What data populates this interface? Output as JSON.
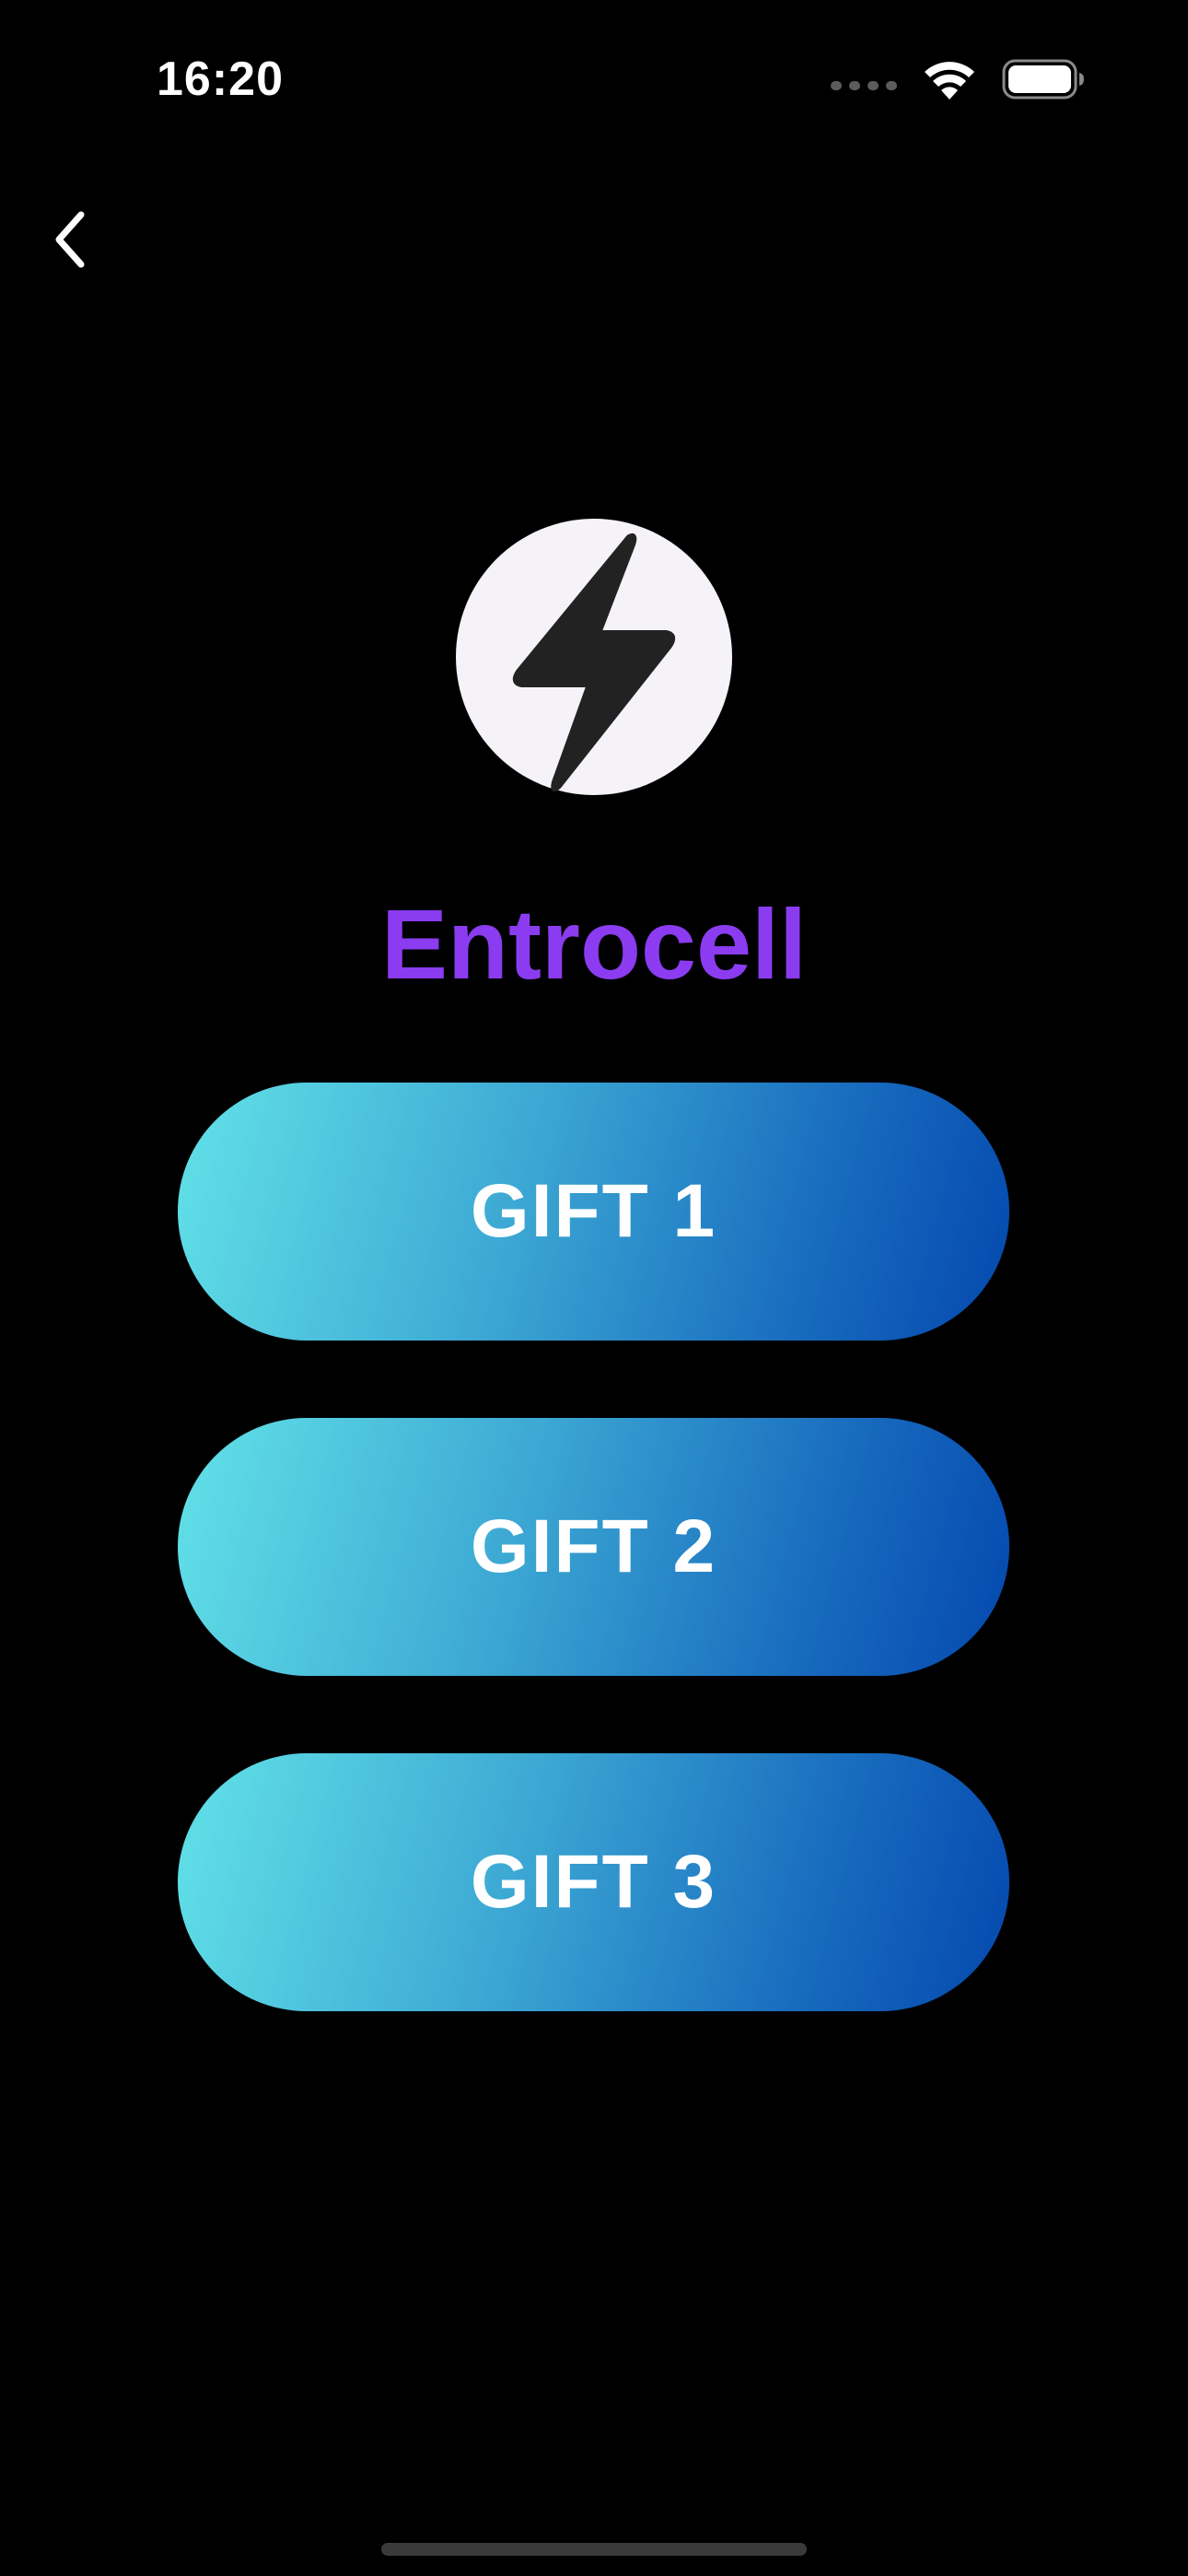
{
  "status_bar": {
    "time": "16:20",
    "icons": [
      "cellular-signal-icon",
      "wifi-icon",
      "battery-icon"
    ]
  },
  "navigation": {
    "back_icon": "chevron-left-icon"
  },
  "app": {
    "logo_icon": "lightning-bolt-icon",
    "name": "Entrocell",
    "name_color": "#8b3cf0"
  },
  "gifts": [
    {
      "label": "GIFT 1"
    },
    {
      "label": "GIFT 2"
    },
    {
      "label": "GIFT 3"
    }
  ],
  "colors": {
    "background": "#000000",
    "button_gradient_start": "#62e2e8",
    "button_gradient_end": "#0448ae",
    "logo_background": "#f5f2f8",
    "logo_bolt": "#222222"
  }
}
